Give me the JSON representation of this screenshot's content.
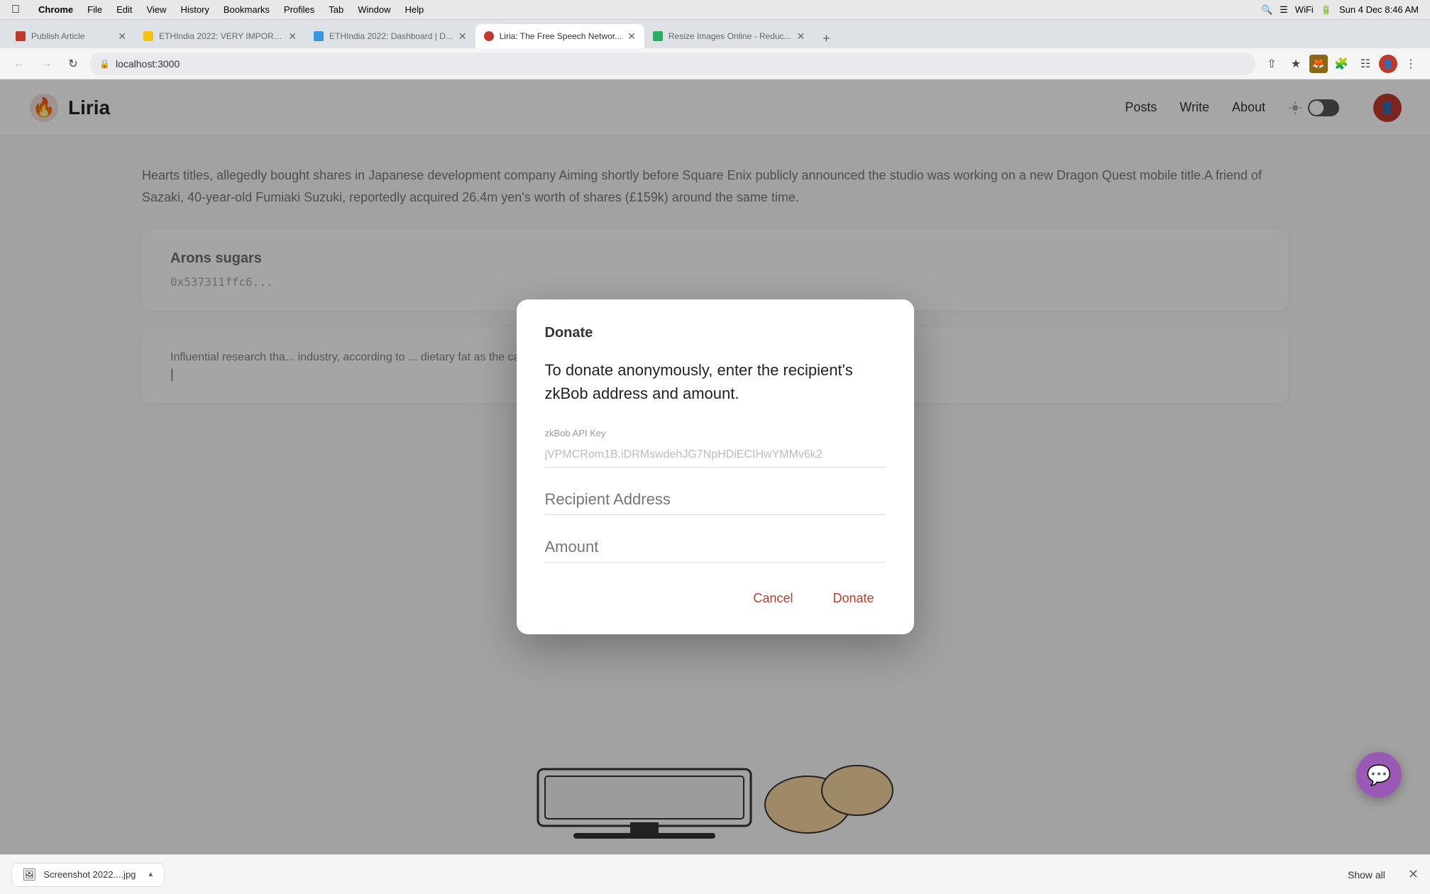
{
  "macos": {
    "menubar": {
      "app": "Chrome",
      "menus": [
        "File",
        "Edit",
        "View",
        "History",
        "Bookmarks",
        "Profiles",
        "Tab",
        "Window",
        "Help"
      ],
      "time": "Sun 4 Dec  8:46 AM"
    }
  },
  "browser": {
    "tabs": [
      {
        "id": "tab1",
        "title": "Publish Article",
        "favicon_type": "red",
        "active": false
      },
      {
        "id": "tab2",
        "title": "ETHIndia 2022: VERY IMPORT...",
        "favicon_type": "yellow",
        "active": false
      },
      {
        "id": "tab3",
        "title": "ETHIndia 2022: Dashboard | D...",
        "favicon_type": "blue",
        "active": false
      },
      {
        "id": "tab4",
        "title": "Liria: The Free Speech Networ...",
        "favicon_type": "red",
        "active": true
      },
      {
        "id": "tab5",
        "title": "Resize Images Online - Reduc...",
        "favicon_type": "green",
        "active": false
      }
    ],
    "url": "localhost:3000",
    "toolbar_actions": [
      "share",
      "star",
      "fox",
      "puzzle",
      "grid",
      "menu"
    ]
  },
  "site": {
    "logo_text": "Liria",
    "nav": {
      "items": [
        "Posts",
        "Write",
        "About"
      ]
    }
  },
  "background": {
    "article_text": "Hearts titles, allegedly bought shares in Japanese development company Aiming shortly before Square Enix publicly announced the studio was working on a new Dragon Quest mobile title.A friend of Sazaki, 40-year-old Fumiaki Suzuki, reportedly acquired 26.4m yen's worth of shares (£159k) around the same time.",
    "card1": {
      "title": "Arons sugars",
      "address": "0x537311ffc6..."
    },
    "card2_text": "Influential research tha... industry, according to ... dietary fat as the caus... published in JAMA Int..."
  },
  "modal": {
    "title": "Donate",
    "description": "To donate anonymously, enter the recipient's zkBob address and amount.",
    "zkbob_label": "zkBob API Key",
    "zkbob_placeholder": "jVPMCRom1B.iDRMswdehJG7NpHDiECIHwYMMv6k2",
    "recipient_label": "Recipient Address",
    "recipient_placeholder": "",
    "amount_label": "Amount",
    "amount_placeholder": "",
    "cancel_btn": "Cancel",
    "donate_btn": "Donate"
  },
  "download_bar": {
    "file_name": "Screenshot 2022....jpg",
    "show_all": "Show all"
  }
}
